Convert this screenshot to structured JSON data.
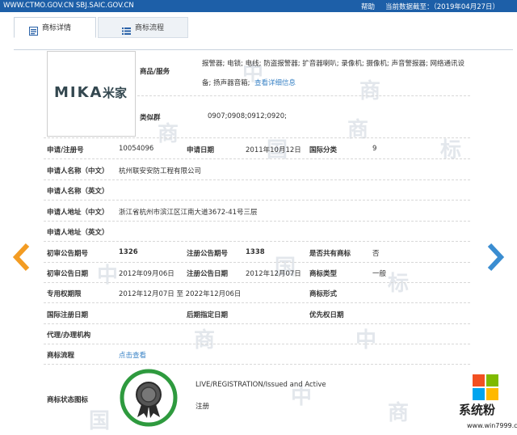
{
  "topbar": {
    "site": "WWW.CTMO.GOV.CN SBJ.SAIC.GOV.CN",
    "help": "帮助",
    "date": "当前数据截至：（2019年04月27日）"
  },
  "tabs": [
    {
      "label": "商标详情"
    },
    {
      "label": "商标流程"
    }
  ],
  "logo": {
    "latin": "MIKA",
    "cn": "米家"
  },
  "fields": {
    "goods_label": "商品/服务",
    "goods_value_line1": "报警器; 电锁; 电线; 防盗报警器; 扩音器喇叭; 录像机; 摄像机; 声音警报器; 网络通讯设",
    "goods_value_line2": "备; 扬声器音箱;",
    "goods_link": "查看详细信息",
    "class_group_label": "类似群",
    "class_group_value": "0907;0908;0912;0920;",
    "reg_no_label": "申请/注册号",
    "reg_no_value": "10054096",
    "app_date_label": "申请日期",
    "app_date_value": "2011年10月12日",
    "intl_class_label": "国际分类",
    "intl_class_value": "9",
    "applicant_cn_label": "申请人名称（中文）",
    "applicant_cn_value": "杭州联安安防工程有限公司",
    "applicant_en_label": "申请人名称（英文）",
    "addr_cn_label": "申请人地址（中文）",
    "addr_cn_value": "浙江省杭州市滨江区江南大道3672-41号三层",
    "addr_en_label": "申请人地址（英文）",
    "prelim_no_label": "初审公告期号",
    "prelim_no_value": "1326",
    "reg_pub_no_label": "注册公告期号",
    "reg_pub_no_value": "1338",
    "shared_label": "是否共有商标",
    "shared_value": "否",
    "prelim_date_label": "初审公告日期",
    "prelim_date_value": "2012年09月06日",
    "reg_pub_date_label": "注册公告日期",
    "reg_pub_date_value": "2012年12月07日",
    "mark_type_label": "商标类型",
    "mark_type_value": "一般",
    "exclusive_label": "专用权期限",
    "exclusive_value": "2012年12月07日 至 2022年12月06日",
    "mark_form_label": "商标形式",
    "intl_reg_date_label": "国际注册日期",
    "later_date_label": "后期指定日期",
    "priority_date_label": "优先权日期",
    "agent_label": "代理/办理机构",
    "flow_label": "商标流程",
    "flow_link": "点击查看",
    "status_label": "商标状态图标",
    "status_en": "LIVE/REGISTRATION/Issued and Active",
    "status_cn": "注册"
  },
  "watermark": {
    "char1": "中",
    "char2": "国",
    "char3": "商",
    "char4": "标"
  },
  "brand": {
    "name": "系统粉",
    "url": "www.win7999.com"
  },
  "colors": {
    "topbar": "#1d5fa8",
    "arrow_left": "#f39c23",
    "arrow_right": "#3a8dd1",
    "badge_green": "#2e9a3e",
    "link": "#3a83c6"
  },
  "icons": [
    "tab-detail-icon",
    "tab-flow-icon",
    "arrow-left-icon",
    "arrow-right-icon",
    "certificate-badge-icon",
    "windows-logo-icon"
  ]
}
